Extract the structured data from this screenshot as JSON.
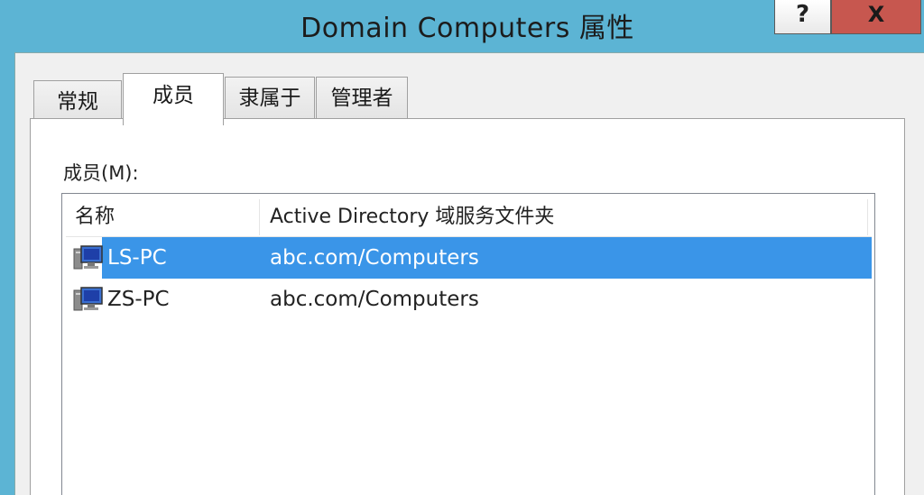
{
  "window": {
    "title": "Domain Computers 属性",
    "help_label": "?",
    "close_label": "X"
  },
  "tabs": [
    {
      "label": "常规",
      "active": false
    },
    {
      "label": "成员",
      "active": true
    },
    {
      "label": "隶属于",
      "active": false
    },
    {
      "label": "管理者",
      "active": false
    }
  ],
  "members": {
    "label": "成员(M):",
    "columns": [
      "名称",
      "Active Directory 域服务文件夹"
    ],
    "rows": [
      {
        "name": "LS-PC",
        "folder": "abc.com/Computers",
        "selected": true,
        "icon": "computer-icon"
      },
      {
        "name": "ZS-PC",
        "folder": "abc.com/Computers",
        "selected": false,
        "icon": "computer-icon"
      }
    ]
  },
  "colors": {
    "titlebar": "#5cb4d4",
    "close_button": "#c7574f",
    "selection": "#3a95e8"
  }
}
